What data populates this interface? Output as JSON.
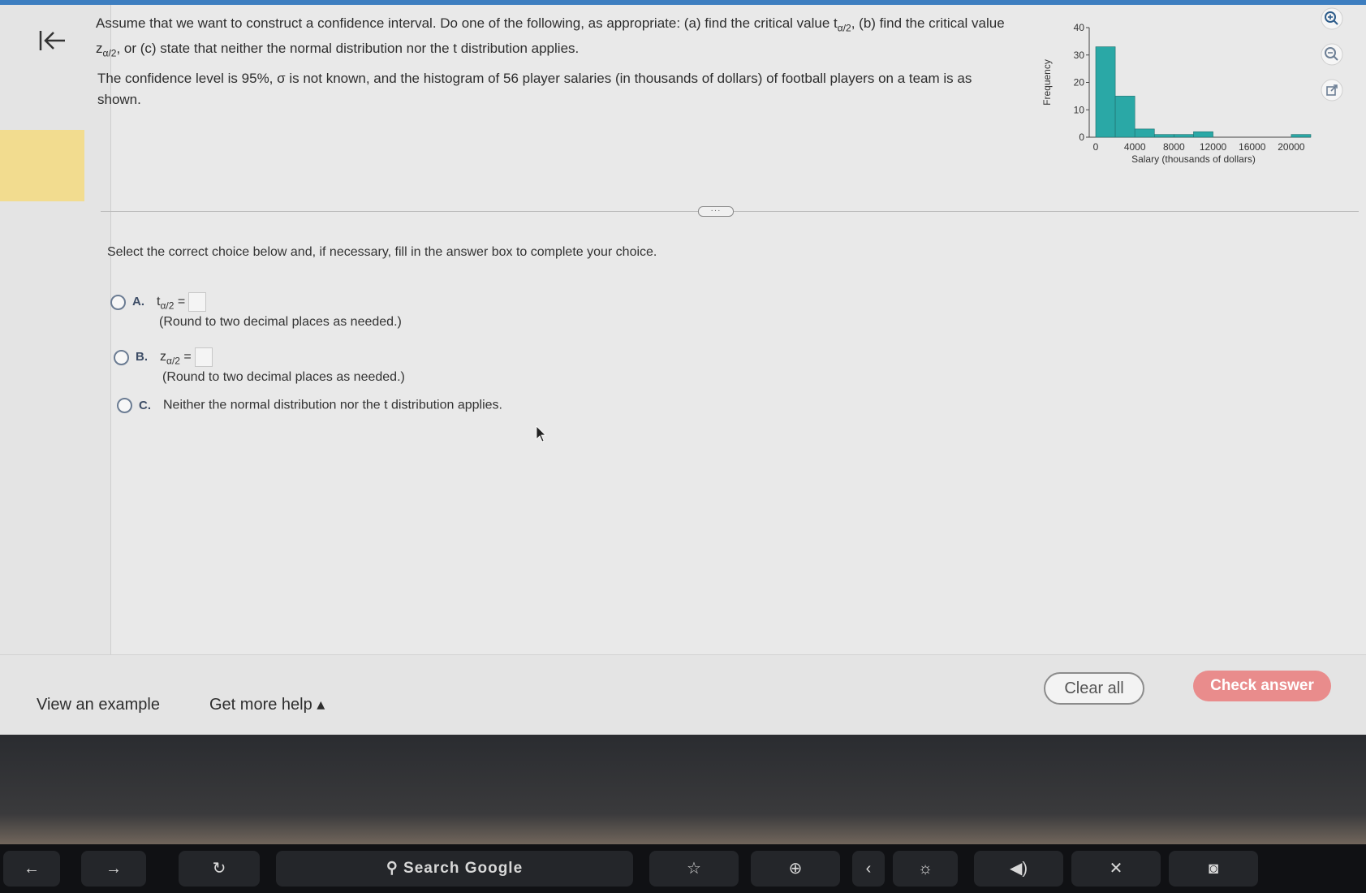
{
  "question": {
    "part1_a": "Assume that we want to construct a confidence interval. Do one of the following, as appropriate: (a) find the critical value t",
    "part1_sub1": "α/2",
    "part1_b": ", (b) find the critical value z",
    "part1_sub2": "α/2",
    "part1_c": ", or (c) state that neither the normal distribution nor the t distribution applies.",
    "part2": "The confidence level is 95%, σ is not known, and the histogram of 56 player salaries (in thousands of dollars) of football players on a team is as shown."
  },
  "expand_handle": "···",
  "instruction": "Select the correct choice below and, if necessary, fill in the answer box to complete your choice.",
  "choices": [
    {
      "letter": "A.",
      "var": "t",
      "sub": "α/2",
      "eq": "=",
      "note": "(Round to two decimal places as needed.)"
    },
    {
      "letter": "B.",
      "var": "z",
      "sub": "α/2",
      "eq": "=",
      "note": "(Round to two decimal places as needed.)"
    },
    {
      "letter": "C.",
      "text": "Neither the normal distribution nor the t distribution applies."
    }
  ],
  "chart_data": {
    "type": "bar",
    "xlabel": "Salary (thousands of dollars)",
    "ylabel": "Frequency",
    "ylim": [
      0,
      40
    ],
    "yticks": [
      0,
      10,
      20,
      30,
      40
    ],
    "xticks": [
      0,
      4000,
      8000,
      12000,
      16000,
      20000
    ],
    "xtick_labels": [
      "0",
      "4000",
      "8000",
      "12000",
      "16000",
      "20000"
    ],
    "bin_width": 2000,
    "bins": [
      0,
      2000,
      4000,
      6000,
      8000,
      10000,
      12000,
      14000,
      16000,
      18000,
      20000
    ],
    "values": [
      33,
      15,
      3,
      1,
      1,
      2,
      0,
      0,
      0,
      0,
      1
    ],
    "bar_color": "#2aa8a6"
  },
  "bottom": {
    "view_example": "View an example",
    "get_more_help": "Get more help ▴",
    "clear_all": "Clear all",
    "check_answer": "Check answer"
  },
  "touch_bar": {
    "search": "Search Google"
  },
  "icons": [
    "back-to-start-icon",
    "zoom-in-icon",
    "zoom-out-icon",
    "open-external-icon"
  ]
}
